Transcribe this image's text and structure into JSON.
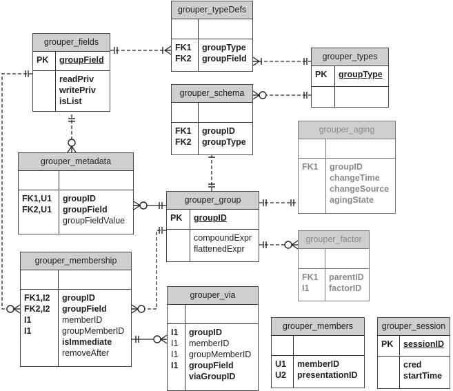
{
  "diagram": {
    "type": "entity-relationship",
    "entities": {
      "grouper_fields": {
        "name": "grouper_fields",
        "pk": {
          "keys": [
            "PK"
          ],
          "columns": [
            {
              "name": "groupField",
              "bold": true,
              "underline": true
            }
          ]
        },
        "attrs": {
          "keys": [],
          "columns": [
            {
              "name": "readPriv",
              "bold": true
            },
            {
              "name": "writePriv",
              "bold": true
            },
            {
              "name": "isList",
              "bold": true
            }
          ]
        }
      },
      "grouper_typeDefs": {
        "name": "grouper_typeDefs",
        "pk": {
          "keys": [],
          "columns": []
        },
        "attrs": {
          "keys": [
            "FK1",
            "FK2"
          ],
          "columns": [
            {
              "name": "groupType",
              "bold": true
            },
            {
              "name": "groupField",
              "bold": true
            }
          ]
        }
      },
      "grouper_types": {
        "name": "grouper_types",
        "pk": {
          "keys": [
            "PK"
          ],
          "columns": [
            {
              "name": "groupType",
              "bold": true,
              "underline": true
            }
          ]
        },
        "attrs": {
          "keys": [],
          "columns": []
        }
      },
      "grouper_schema": {
        "name": "grouper_schema",
        "pk": {
          "keys": [],
          "columns": []
        },
        "attrs": {
          "keys": [
            "FK1",
            "FK2"
          ],
          "columns": [
            {
              "name": "groupID",
              "bold": true
            },
            {
              "name": "groupType",
              "bold": true
            }
          ]
        }
      },
      "grouper_aging": {
        "name": "grouper_aging",
        "muted": true,
        "pk": {
          "keys": [],
          "columns": []
        },
        "attrs": {
          "keys": [
            "FK1"
          ],
          "columns": [
            {
              "name": "groupID",
              "bold": true
            },
            {
              "name": "changeTime",
              "bold": true
            },
            {
              "name": "changeSource",
              "bold": true
            },
            {
              "name": "agingState",
              "bold": true
            }
          ]
        }
      },
      "grouper_metadata": {
        "name": "grouper_metadata",
        "pk": {
          "keys": [],
          "columns": []
        },
        "attrs": {
          "keys": [
            "FK1,U1",
            "FK2,U1"
          ],
          "columns": [
            {
              "name": "groupID",
              "bold": true
            },
            {
              "name": "groupField",
              "bold": true
            },
            {
              "name": "groupFieldValue",
              "bold": false
            }
          ]
        }
      },
      "grouper_group": {
        "name": "grouper_group",
        "pk": {
          "keys": [
            "PK"
          ],
          "columns": [
            {
              "name": "groupID",
              "bold": true,
              "underline": true
            }
          ]
        },
        "attrs": {
          "keys": [],
          "columns": [
            {
              "name": "compoundExpr",
              "bold": false
            },
            {
              "name": "flattenedExpr",
              "bold": false
            }
          ]
        }
      },
      "grouper_factor": {
        "name": "grouper_factor",
        "muted": true,
        "pk": {
          "keys": [],
          "columns": []
        },
        "attrs": {
          "keys": [
            "FK1",
            "I1"
          ],
          "columns": [
            {
              "name": "parentID",
              "bold": true
            },
            {
              "name": "factorID",
              "bold": true
            }
          ]
        }
      },
      "grouper_membership": {
        "name": "grouper_membership",
        "pk": {
          "keys": [],
          "columns": []
        },
        "attrs": {
          "keys": [
            "FK1,I2",
            "FK2,I2",
            "I1",
            "I1"
          ],
          "columns": [
            {
              "name": "groupID",
              "bold": true
            },
            {
              "name": "groupField",
              "bold": true
            },
            {
              "name": "memberID",
              "bold": false
            },
            {
              "name": "groupMemberID",
              "bold": false
            },
            {
              "name": "isImmediate",
              "bold": true
            },
            {
              "name": "removeAfter",
              "bold": false
            }
          ]
        }
      },
      "grouper_via": {
        "name": "grouper_via",
        "pk": {
          "keys": [],
          "columns": []
        },
        "attrs": {
          "keys": [
            "I1",
            "I1",
            "I1",
            "I1"
          ],
          "key_bold": [
            true,
            false,
            false,
            true
          ],
          "columns": [
            {
              "name": "groupID",
              "bold": true
            },
            {
              "name": "memberID",
              "bold": false
            },
            {
              "name": "groupMemberID",
              "bold": false
            },
            {
              "name": "groupField",
              "bold": true
            },
            {
              "name": "viaGroupID",
              "bold": true
            }
          ]
        }
      },
      "grouper_members": {
        "name": "grouper_members",
        "pk": {
          "keys": [],
          "columns": []
        },
        "attrs": {
          "keys": [
            "U1",
            "U2"
          ],
          "columns": [
            {
              "name": "memberID",
              "bold": true
            },
            {
              "name": "presentationID",
              "bold": true
            }
          ]
        }
      },
      "grouper_session": {
        "name": "grouper_session",
        "pk": {
          "keys": [
            "PK"
          ],
          "columns": [
            {
              "name": "sessionID",
              "bold": true,
              "underline": true
            }
          ]
        },
        "attrs": {
          "keys": [],
          "columns": [
            {
              "name": "cred",
              "bold": true
            },
            {
              "name": "startTime",
              "bold": true
            }
          ]
        }
      }
    },
    "relationships": [
      {
        "from": "grouper_fields",
        "to": "grouper_typeDefs",
        "from_card": "one-and-only-one",
        "to_card": "one-or-many",
        "style": "dashed"
      },
      {
        "from": "grouper_types",
        "to": "grouper_typeDefs",
        "from_card": "one-and-only-one",
        "to_card": "one-or-many",
        "style": "dashed"
      },
      {
        "from": "grouper_types",
        "to": "grouper_schema",
        "from_card": "one-and-only-one",
        "to_card": "zero-or-many",
        "style": "dashed"
      },
      {
        "from": "grouper_fields",
        "to": "grouper_metadata",
        "from_card": "one-and-only-one",
        "to_card": "zero-or-many",
        "style": "dashed"
      },
      {
        "from": "grouper_group",
        "to": "grouper_schema",
        "from_card": "one-and-only-one",
        "to_card": "one-or-many",
        "style": "dashed"
      },
      {
        "from": "grouper_group",
        "to": "grouper_metadata",
        "from_card": "one-and-only-one",
        "to_card": "zero-or-many",
        "style": "solid"
      },
      {
        "from": "grouper_group",
        "to": "grouper_aging",
        "from_card": "one-and-only-one",
        "to_card": "one-and-only-one",
        "style": "dashed"
      },
      {
        "from": "grouper_group",
        "to": "grouper_factor",
        "from_card": "one-and-only-one",
        "to_card": "zero-or-many",
        "style": "dashed"
      },
      {
        "from": "grouper_group",
        "to": "grouper_membership",
        "from_card": "one-and-only-one",
        "to_card": "zero-or-many",
        "style": "dashed"
      },
      {
        "from": "grouper_fields",
        "to": "grouper_membership",
        "from_card": "one-and-only-one",
        "to_card": "zero-or-many",
        "style": "dashed"
      },
      {
        "from": "grouper_membership",
        "to": "grouper_via",
        "from_card": "one-and-only-one",
        "to_card": "zero-or-many",
        "style": "solid"
      }
    ]
  }
}
